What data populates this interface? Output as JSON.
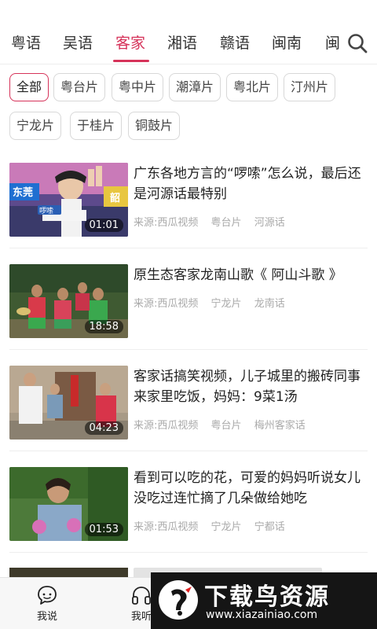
{
  "tabs": [
    "粤语",
    "吴语",
    "客家",
    "湘语",
    "赣语",
    "闽南",
    "闽"
  ],
  "active_tab": 2,
  "chips": [
    "全部",
    "粤台片",
    "粤中片",
    "潮漳片",
    "粤北片",
    "汀州片",
    "宁龙片",
    "于桂片",
    "铜鼓片"
  ],
  "videos": [
    {
      "title": "广东各地方言的“啰嗦”怎么说，最后还是河源话最特别",
      "source": "来源:西瓜视频",
      "tag1": "粤台片",
      "tag2": "河源话",
      "duration": "01:01",
      "thumb_caption": "东莞",
      "thumb_badge": "啰嗦",
      "thumb_side": "韶"
    },
    {
      "title": "原生态客家龙南山歌《 阿山斗歌 》",
      "source": "来源:西瓜视频",
      "tag1": "宁龙片",
      "tag2": "龙南话",
      "duration": "18:58"
    },
    {
      "title": "客家话搞笑视频，儿子城里的搬砖同事来家里吃饭，妈妈：9菜1汤",
      "source": "来源:西瓜视频",
      "tag1": "粤台片",
      "tag2": "梅州客家话",
      "duration": "04:23"
    },
    {
      "title": "看到可以吃的花，可爱的妈妈听说女儿没吃过连忙摘了几朵做给她吃",
      "source": "来源:西瓜视频",
      "tag1": "宁龙片",
      "tag2": "宁都话",
      "duration": "01:53"
    }
  ],
  "nav": [
    "我说",
    "我听"
  ],
  "watermark": {
    "cn": "下载鸟资源",
    "url": "www.xiazainiao.com"
  },
  "colors": {
    "accent": "#d6335a"
  }
}
